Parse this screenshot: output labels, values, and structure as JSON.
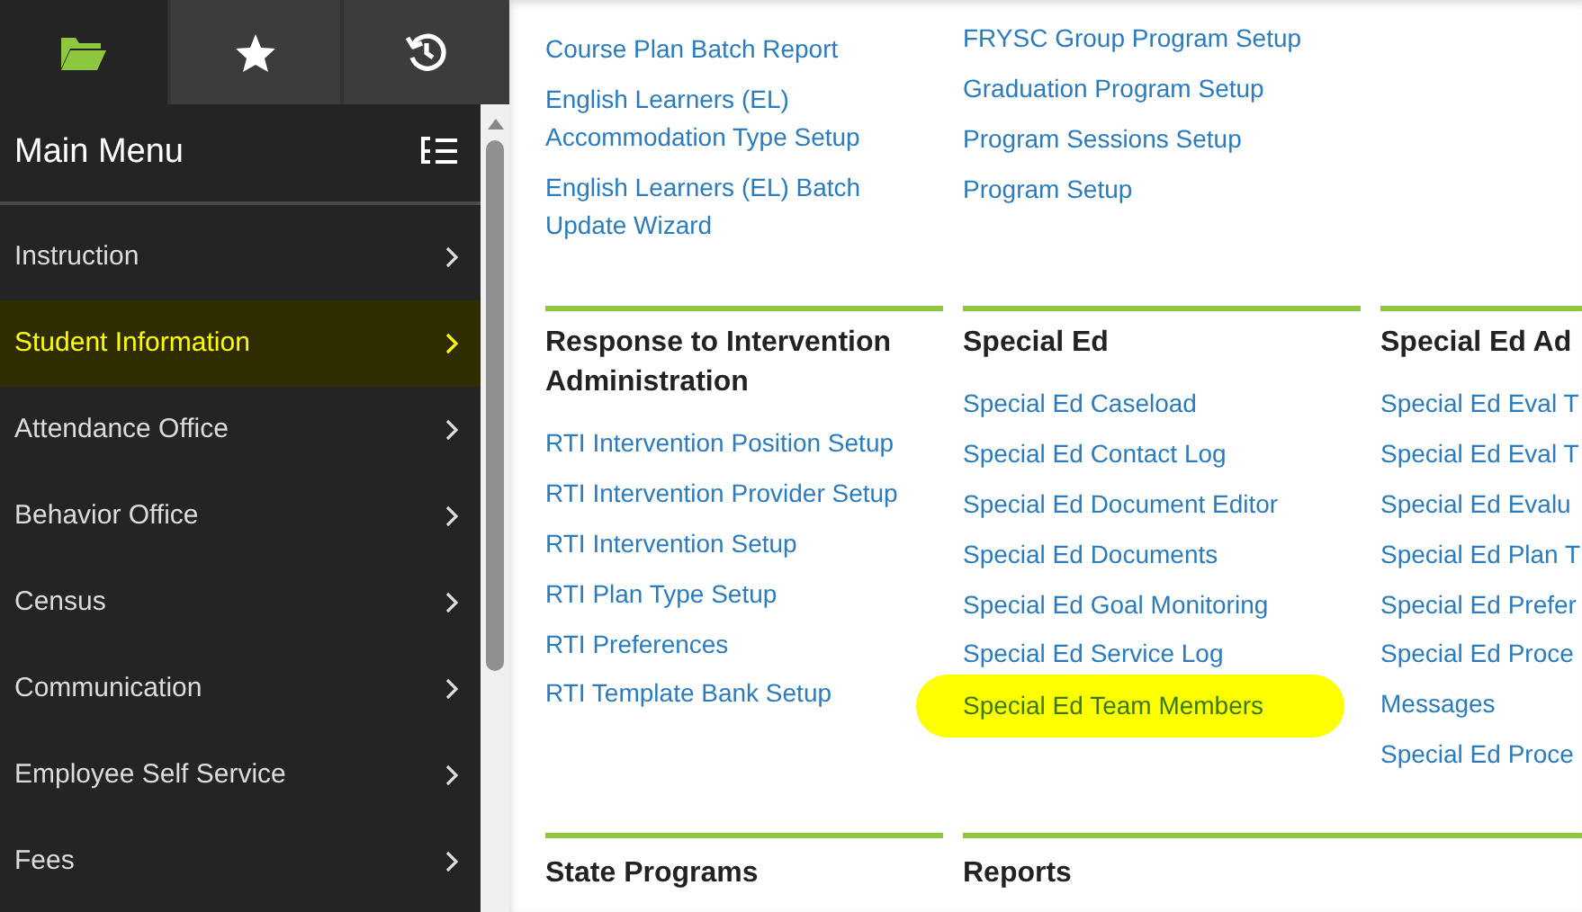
{
  "sidebar": {
    "tabs": [
      {
        "kind": "folder",
        "selected": true
      },
      {
        "kind": "star",
        "selected": false
      },
      {
        "kind": "history",
        "selected": false
      }
    ],
    "title": "Main Menu",
    "items": [
      {
        "label": "Instruction",
        "highlighted": false
      },
      {
        "label": "Student Information",
        "highlighted": true
      },
      {
        "label": "Attendance Office",
        "highlighted": false
      },
      {
        "label": "Behavior Office",
        "highlighted": false
      },
      {
        "label": "Census",
        "highlighted": false
      },
      {
        "label": "Communication",
        "highlighted": false
      },
      {
        "label": "Employee Self Service",
        "highlighted": false
      },
      {
        "label": "Fees",
        "highlighted": false
      }
    ]
  },
  "rows": [
    [
      {
        "link_columns": [
          [
            {
              "label": "Course Plan Batch Report",
              "highlighted": false
            },
            {
              "label": "English Learners (EL) Accommodation Type Setup",
              "highlighted": false
            },
            {
              "label": "English Learners (EL) Batch Update Wizard",
              "highlighted": false
            }
          ]
        ]
      },
      {
        "link_columns": [
          [
            {
              "label": "FRYSC Group Program Setup",
              "highlighted": false
            },
            {
              "label": "Graduation Program Setup",
              "highlighted": false
            },
            {
              "label": "Program Sessions Setup",
              "highlighted": false
            },
            {
              "label": "Program Setup",
              "highlighted": false
            }
          ]
        ]
      }
    ],
    [
      {
        "title": "Response to Intervention Administration",
        "link_columns": [
          [
            {
              "label": "RTI Intervention Position Setup",
              "highlighted": false
            },
            {
              "label": "RTI Intervention Provider Setup",
              "highlighted": false
            },
            {
              "label": "RTI Intervention Setup",
              "highlighted": false
            },
            {
              "label": "RTI Plan Type Setup",
              "highlighted": false
            },
            {
              "label": "RTI Preferences",
              "highlighted": false
            },
            {
              "label": "RTI Template Bank Setup",
              "highlighted": false
            }
          ]
        ]
      },
      {
        "title": "Special Ed",
        "link_columns": [
          [
            {
              "label": "Special Ed Caseload",
              "highlighted": false
            },
            {
              "label": "Special Ed Contact Log",
              "highlighted": false
            },
            {
              "label": "Special Ed Document Editor",
              "highlighted": false
            },
            {
              "label": "Special Ed Documents",
              "highlighted": false
            },
            {
              "label": "Special Ed Goal Monitoring",
              "highlighted": false
            },
            {
              "label": "Special Ed Service Log",
              "highlighted": false
            },
            {
              "label": "Special Ed Team Members",
              "highlighted": true
            }
          ]
        ]
      },
      {
        "title": "Special Ed Ad",
        "link_columns": [
          [
            {
              "label": "Special Ed Eval T",
              "highlighted": false
            },
            {
              "label": "Special Ed Eval T",
              "highlighted": false
            },
            {
              "label": "Special Ed Evalu",
              "highlighted": false
            },
            {
              "label": "Special Ed Plan T",
              "highlighted": false
            },
            {
              "label": "Special Ed Prefer",
              "highlighted": false
            },
            {
              "label": "Special Ed Proce",
              "highlighted": false
            },
            {
              "label": "Messages",
              "highlighted": false
            },
            {
              "label": "Special Ed Proce",
              "highlighted": false
            }
          ]
        ]
      }
    ],
    [
      {
        "title": "State Programs"
      },
      {
        "title": "Reports"
      }
    ]
  ]
}
